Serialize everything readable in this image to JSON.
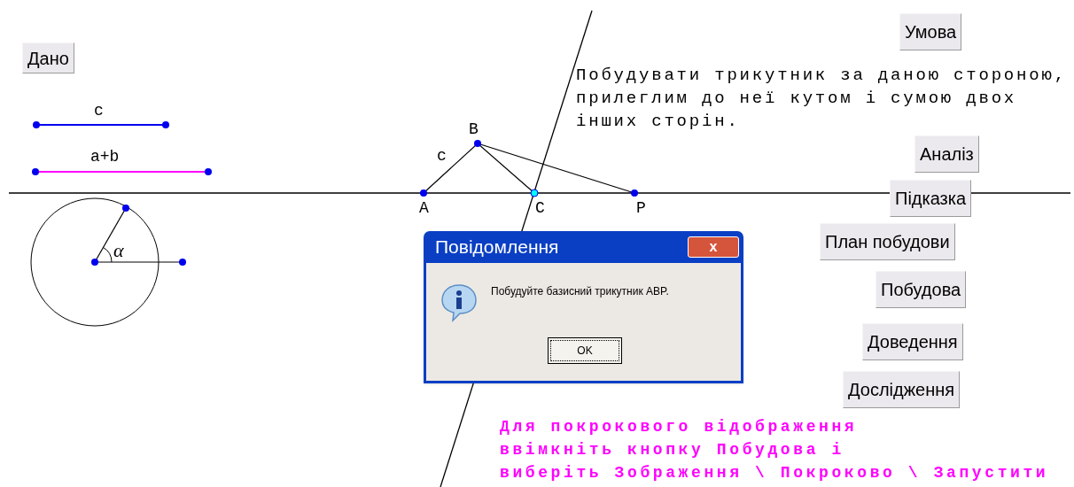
{
  "buttons": [
    {
      "label": "Дано"
    },
    {
      "label": "Умова"
    },
    {
      "label": "Аналіз"
    },
    {
      "label": "Підказка"
    },
    {
      "label": "План побудови"
    },
    {
      "label": "Побудова"
    },
    {
      "label": "Доведення"
    },
    {
      "label": "Дослідження"
    }
  ],
  "canvas_labels": [
    "c",
    "a+b",
    "α",
    "B",
    "c",
    "A",
    "C",
    "P"
  ],
  "task_lines": [
    "Побудувати трикутник за даною стороною,",
    "прилеглим до неї кутом і сумою двох",
    "інших сторін."
  ],
  "hint_lines": [
    "Для покрокового відображення",
    "ввімкніть кнопку Побудова і",
    "виберіть Зображення \\ Покроково \\ Запустити"
  ],
  "dialog": {
    "title": "Повідомлення",
    "close": "x",
    "message": "Побудуйте базисний трикутник ABP.",
    "button": "OK"
  }
}
